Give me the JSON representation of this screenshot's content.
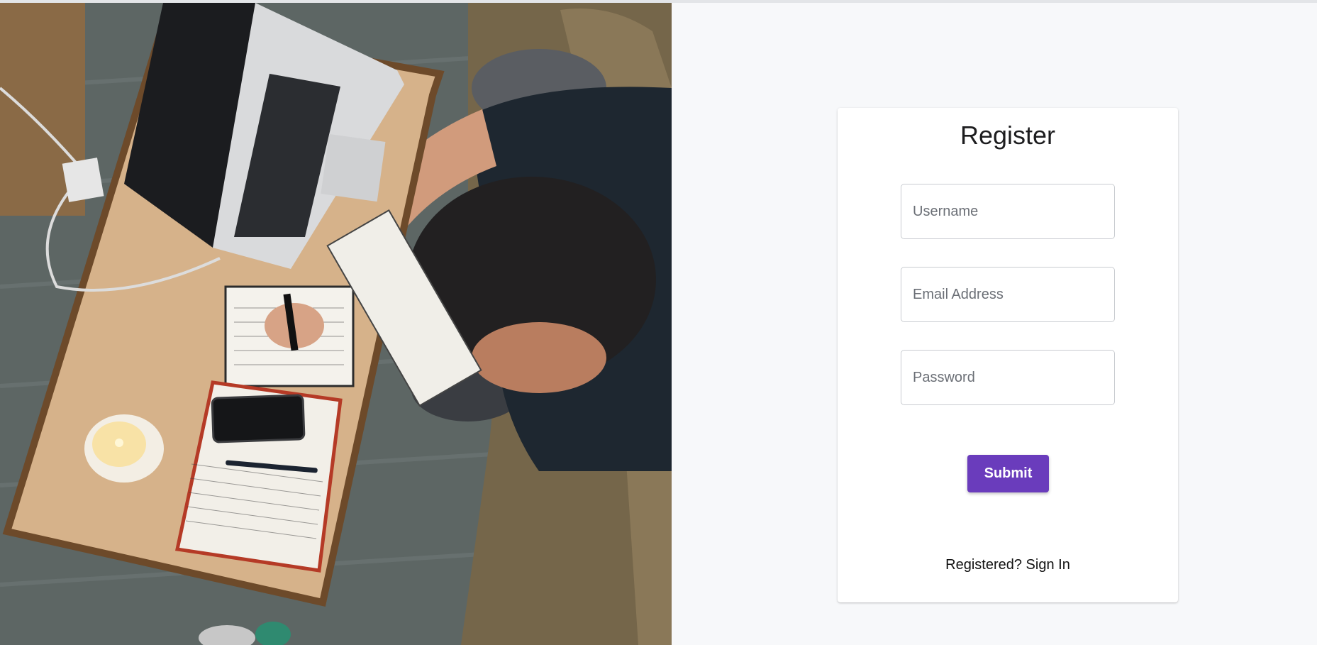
{
  "hero": {
    "alt": "Person writing in a notebook at a wooden table with a laptop, phone, candle and journal"
  },
  "form": {
    "title": "Register",
    "username_placeholder": "Username",
    "email_placeholder": "Email Address",
    "password_placeholder": "Password",
    "submit_label": "Submit",
    "signin_link": "Registered? Sign In"
  },
  "colors": {
    "accent": "#6a3cbc",
    "panel_background": "#f7f8fa",
    "card_background": "#ffffff"
  }
}
